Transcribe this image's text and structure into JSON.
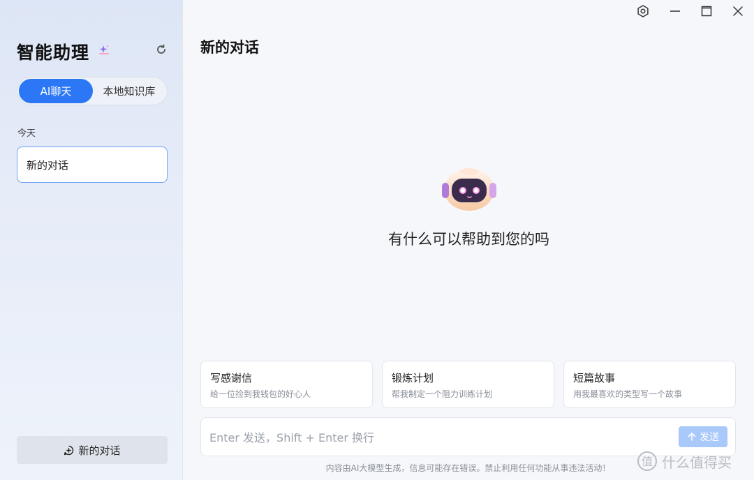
{
  "sidebar": {
    "app_title": "智能助理",
    "tabs": [
      {
        "label": "AI聊天"
      },
      {
        "label": "本地知识库"
      }
    ],
    "section_label": "今天",
    "conversations": [
      {
        "label": "新的对话"
      }
    ],
    "new_chat_label": "新的对话"
  },
  "main": {
    "title": "新的对话",
    "greeting": "有什么可以帮助到您的吗",
    "suggestions": [
      {
        "title": "写感谢信",
        "desc": "给一位捡到我钱包的好心人"
      },
      {
        "title": "锻炼计划",
        "desc": "帮我制定一个阻力训练计划"
      },
      {
        "title": "短篇故事",
        "desc": "用我最喜欢的类型写一个故事"
      }
    ],
    "input_placeholder": "Enter 发送，Shift + Enter 换行",
    "send_label": "发送",
    "disclaimer": "内容由AI大模型生成，信息可能存在错误。禁止利用任何功能从事违法活动！"
  },
  "watermark": "什么值得买",
  "colors": {
    "accent": "#2b77f6",
    "send_disabled": "#a9c9fb",
    "active_border": "#6ea1f7"
  },
  "icons": {
    "sparkle": "sparkle-icon",
    "refresh": "refresh-icon",
    "settings": "settings-icon",
    "minimize": "minimize-icon",
    "maximize": "maximize-icon",
    "close": "close-icon",
    "new_chat": "add-chat-icon",
    "send": "arrow-up-icon"
  }
}
